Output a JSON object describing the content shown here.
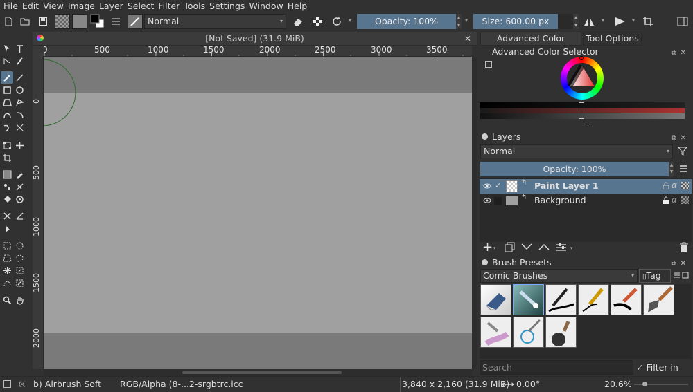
{
  "menu": [
    "File",
    "Edit",
    "View",
    "Image",
    "Layer",
    "Select",
    "Filter",
    "Tools",
    "Settings",
    "Window",
    "Help"
  ],
  "toolbar": {
    "blend_mode": "Normal",
    "opacity_label": "Opacity: 100%",
    "size_label": "Size: 600.00 px"
  },
  "document": {
    "tab_title": "[Not Saved]  (31.9 MiB)",
    "hruler_ticks": [
      "0",
      "500",
      "1000",
      "1500",
      "2000",
      "2500",
      "3000",
      "3500"
    ],
    "vruler_ticks": [
      "0",
      "500",
      "1000",
      "1500",
      "2000"
    ]
  },
  "dock_tabs": [
    "Advanced Color Selector",
    "Tool Options"
  ],
  "color_selector": {
    "title": "Advanced Color Selector"
  },
  "layers": {
    "title": "Layers",
    "blend_mode": "Normal",
    "opacity_label": "Opacity:  100%",
    "items": [
      {
        "name": "Paint Layer 1",
        "selected": true
      },
      {
        "name": "Background",
        "selected": false
      }
    ]
  },
  "brush_presets": {
    "title": "Brush Presets",
    "tag_value": "Comic Brushes",
    "tag_button": "Tag",
    "search_placeholder": "Search",
    "filter_label": "Filter in Tag"
  },
  "status": {
    "brush": "b) Airbrush Soft",
    "color_space": "RGB/Alpha (8-...2-srgbtrc.icc",
    "dimensions": "3,840 x 2,160 (31.9 MiB)",
    "rotation": "0.00°",
    "zoom": "20.6%"
  },
  "colors": {
    "accent": "#587590",
    "selected_row": "#587590"
  }
}
